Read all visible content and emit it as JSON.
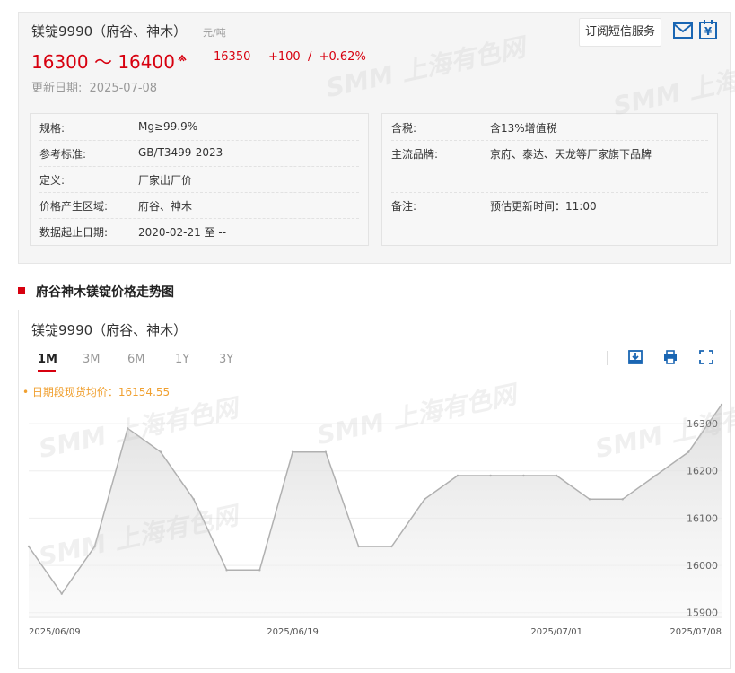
{
  "product": {
    "name": "镁锭9990（府谷、神木）",
    "unit": "元/吨",
    "price_range": "16300 ～ 16400",
    "average": "16350",
    "change": "+100  /  +0.62%",
    "update_label": "更新日期:",
    "update_date": "2025-07-08",
    "subscribe_label": "订阅短信服务"
  },
  "specs_left": [
    {
      "k": "规格:",
      "v": "Mg≥99.9%"
    },
    {
      "k": "参考标准:",
      "v": "GB/T3499-2023"
    },
    {
      "k": "定义:",
      "v": "厂家出厂价"
    },
    {
      "k": "价格产生区域:",
      "v": "府谷、神木"
    },
    {
      "k": "数据起止日期:",
      "v": "2020-02-21 至 --"
    }
  ],
  "specs_right": [
    {
      "k": "含税:",
      "v": "含13%增值税"
    },
    {
      "k": "主流品牌:",
      "v": "京府、泰达、天龙等厂家旗下品牌"
    },
    {
      "k": "备注:",
      "v": "预估更新时间：11:00"
    }
  ],
  "section": {
    "title": "府谷神木镁锭价格走势图"
  },
  "chart": {
    "name": "镁锭9990（府谷、神木）",
    "tabs": [
      "1M",
      "3M",
      "6M",
      "1Y",
      "3Y"
    ],
    "active_tab": "1M",
    "avg_label": "• 日期段现货均价：16154.55",
    "tools": [
      "download-icon",
      "print-icon",
      "fullscreen-icon"
    ]
  },
  "watermark": "SMM 上海有色网",
  "colors": {
    "accent": "#d7000f",
    "avg_label": "#f0a030",
    "line": "#b0b0b0"
  },
  "chart_data": {
    "type": "area",
    "x": [
      "2025/06/09",
      "2025/06/10",
      "2025/06/11",
      "2025/06/12",
      "2025/06/13",
      "2025/06/16",
      "2025/06/17",
      "2025/06/18",
      "2025/06/19",
      "2025/06/20",
      "2025/06/23",
      "2025/06/24",
      "2025/06/25",
      "2025/06/26",
      "2025/06/27",
      "2025/06/30",
      "2025/07/01",
      "2025/07/02",
      "2025/07/03",
      "2025/07/04",
      "2025/07/07",
      "2025/07/08"
    ],
    "series": [
      {
        "values": [
          16040,
          15940,
          16040,
          16290,
          16240,
          16140,
          15990,
          15990,
          16240,
          16240,
          16040,
          16040,
          16140,
          16190,
          16190,
          16190,
          16190,
          16140,
          16140,
          16190,
          16240,
          16340
        ]
      }
    ],
    "x_ticks": [
      "2025/06/09",
      "2025/06/19",
      "2025/07/01",
      "2025/07/08"
    ],
    "y_ticks": [
      15900,
      16000,
      16100,
      16200,
      16300
    ],
    "ylim": [
      15890,
      16340
    ],
    "grid": true
  }
}
